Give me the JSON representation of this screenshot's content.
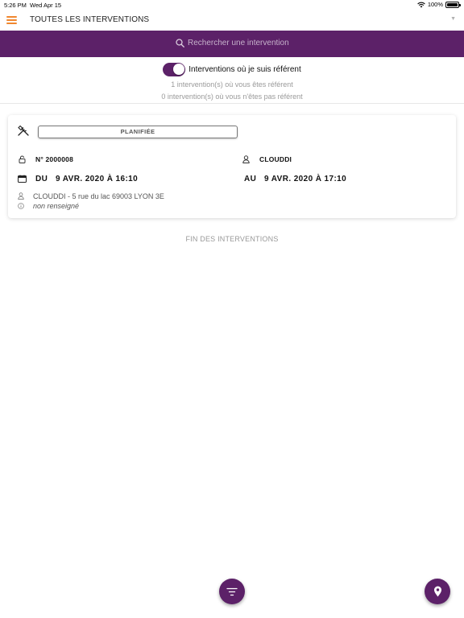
{
  "status_bar": {
    "time": "5:26 PM",
    "date": "Wed Apr 15",
    "battery": "100%",
    "icons": [
      "wifi-icon",
      "battery-icon"
    ]
  },
  "header": {
    "title": "TOUTES LES INTERVENTIONS",
    "menu_icon": "hamburger-icon",
    "caret_icon": "caret-down-icon",
    "menu_color": "#f0872f"
  },
  "search": {
    "placeholder": "Rechercher une intervention",
    "icon": "search-icon"
  },
  "filter_toggle": {
    "label": "Interventions où je suis référent",
    "checked": true
  },
  "counts": {
    "referent": "1 intervention(s) où vous êtes référent",
    "non_referent": "0 intervention(s) où vous n'êtes pas référent"
  },
  "interventions": [
    {
      "status": "PLANIFIÉE",
      "number": "N° 2000008",
      "client": "CLOUDDI",
      "start_label": "DU",
      "start_date": "9 AVR. 2020 À 16:10",
      "end_label": "AU",
      "end_date": "9 AVR. 2020 À 17:10",
      "address": "CLOUDDI - 5 rue du lac 69003 LYON 3E",
      "info": "non renseigné",
      "icons": [
        "tools-icon",
        "lock-icon",
        "user-icon",
        "calendar-icon",
        "user-icon",
        "info-icon"
      ]
    }
  ],
  "list_end": "FIN DES INTERVENTIONS",
  "actions": {
    "filter_icon": "filter-icon",
    "map_icon": "map-pin-icon"
  },
  "colors": {
    "primary": "#5c2168",
    "accent": "#f0872f"
  }
}
